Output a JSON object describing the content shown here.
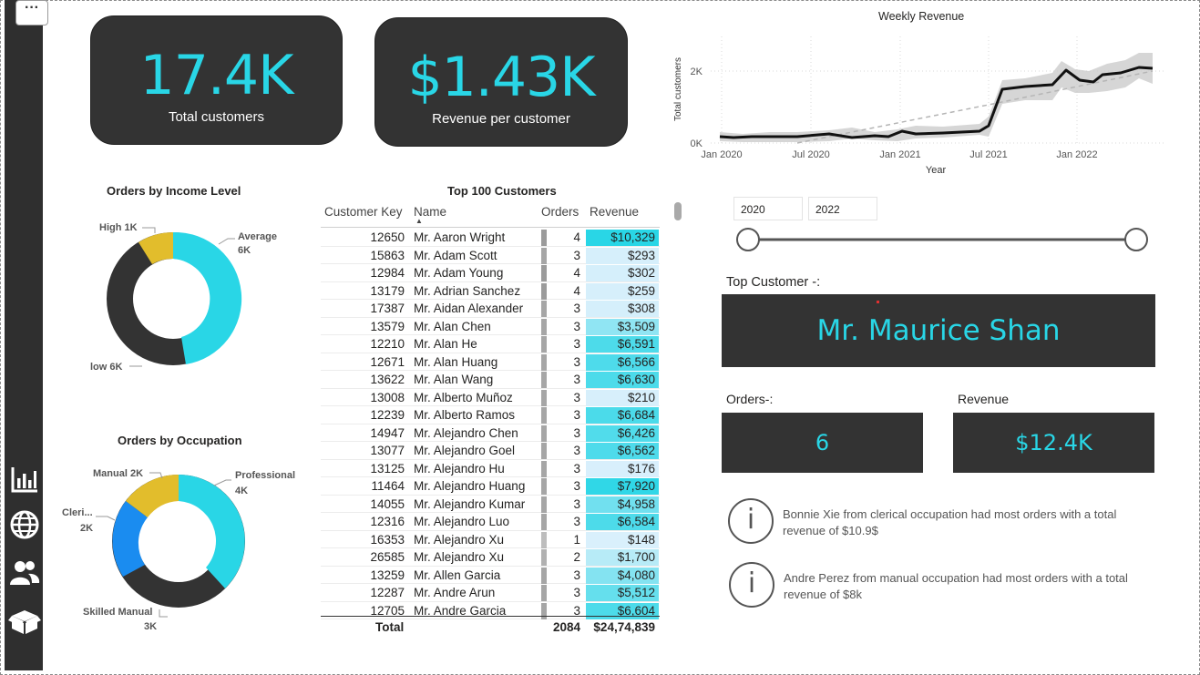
{
  "nav": {
    "more_label": "···",
    "icons": [
      "bar-chart-icon",
      "globe-icon",
      "users-icon",
      "box-icon"
    ]
  },
  "kpis": [
    {
      "value": "17.4K",
      "label": "Total customers"
    },
    {
      "value": "$1.43K",
      "label": "Revenue per customer"
    }
  ],
  "weekly_chart": {
    "title": "Weekly Revenue",
    "ylabel": "Total customers",
    "xlabel": "Year",
    "y_ticks": [
      "2K",
      "0K"
    ],
    "x_ticks": [
      "Jan 2020",
      "Jul 2020",
      "Jan 2021",
      "Jul 2021",
      "Jan 2022"
    ]
  },
  "income_chart": {
    "title": "Orders by Income Level",
    "labels": [
      {
        "name": "High",
        "value": "1K"
      },
      {
        "name": "Average",
        "value": "6K"
      },
      {
        "name": "low",
        "value": "6K"
      }
    ]
  },
  "occupation_chart": {
    "title": "Orders by Occupation",
    "labels": [
      {
        "name": "Manual",
        "value": "2K"
      },
      {
        "name": "Professional",
        "value": "4K"
      },
      {
        "name": "Cleri...",
        "value": "2K"
      },
      {
        "name": "Skilled Manual",
        "value": "3K"
      }
    ]
  },
  "table": {
    "title": "Top 100 Customers",
    "headers": {
      "key": "Customer Key",
      "name": "Name",
      "orders": "Orders",
      "revenue": "Revenue"
    },
    "rows": [
      {
        "key": "12650",
        "name": "Mr. Aaron Wright",
        "orders": "4",
        "revenue": "$10,329"
      },
      {
        "key": "15863",
        "name": "Mr. Adam Scott",
        "orders": "3",
        "revenue": "$293"
      },
      {
        "key": "12984",
        "name": "Mr. Adam Young",
        "orders": "4",
        "revenue": "$302"
      },
      {
        "key": "13179",
        "name": "Mr. Adrian Sanchez",
        "orders": "4",
        "revenue": "$259"
      },
      {
        "key": "17387",
        "name": "Mr. Aidan Alexander",
        "orders": "3",
        "revenue": "$308"
      },
      {
        "key": "13579",
        "name": "Mr. Alan Chen",
        "orders": "3",
        "revenue": "$3,509"
      },
      {
        "key": "12210",
        "name": "Mr. Alan He",
        "orders": "3",
        "revenue": "$6,591"
      },
      {
        "key": "12671",
        "name": "Mr. Alan Huang",
        "orders": "3",
        "revenue": "$6,566"
      },
      {
        "key": "13622",
        "name": "Mr. Alan Wang",
        "orders": "3",
        "revenue": "$6,630"
      },
      {
        "key": "13008",
        "name": "Mr. Alberto Muñoz",
        "orders": "3",
        "revenue": "$210"
      },
      {
        "key": "12239",
        "name": "Mr. Alberto Ramos",
        "orders": "3",
        "revenue": "$6,684"
      },
      {
        "key": "14947",
        "name": "Mr. Alejandro Chen",
        "orders": "3",
        "revenue": "$6,426"
      },
      {
        "key": "13077",
        "name": "Mr. Alejandro Goel",
        "orders": "3",
        "revenue": "$6,562"
      },
      {
        "key": "13125",
        "name": "Mr. Alejandro Hu",
        "orders": "3",
        "revenue": "$176"
      },
      {
        "key": "11464",
        "name": "Mr. Alejandro Huang",
        "orders": "3",
        "revenue": "$7,920"
      },
      {
        "key": "14055",
        "name": "Mr. Alejandro Kumar",
        "orders": "3",
        "revenue": "$4,958"
      },
      {
        "key": "12316",
        "name": "Mr. Alejandro Luo",
        "orders": "3",
        "revenue": "$6,584"
      },
      {
        "key": "16353",
        "name": "Mr. Alejandro Xu",
        "orders": "1",
        "revenue": "$148"
      },
      {
        "key": "26585",
        "name": "Mr. Alejandro Xu",
        "orders": "2",
        "revenue": "$1,700"
      },
      {
        "key": "13259",
        "name": "Mr. Allen Garcia",
        "orders": "3",
        "revenue": "$4,080"
      },
      {
        "key": "12287",
        "name": "Mr. Andre Arun",
        "orders": "3",
        "revenue": "$5,512"
      },
      {
        "key": "12705",
        "name": "Mr. Andre Garcia",
        "orders": "3",
        "revenue": "$6,604"
      }
    ],
    "total": {
      "label": "Total",
      "orders": "2084",
      "revenue": "$24,74,839"
    }
  },
  "slicer": {
    "start": "2020",
    "end": "2022"
  },
  "top_customer": {
    "label": "Top Customer -:",
    "name": "Mr. Maurice Shan"
  },
  "orders_card": {
    "label": "Orders-:",
    "value": "6"
  },
  "revenue_card": {
    "label": "Revenue",
    "value": "$12.4K"
  },
  "insights": [
    {
      "icon": "i",
      "text": "Bonnie Xie from clerical occupation had most orders with a total revenue of $10.9$"
    },
    {
      "icon": "i",
      "text": "Andre Perez from manual occupation had most orders with a total revenue of $8k"
    }
  ],
  "colors": {
    "accent": "#29d6e6",
    "dark": "#333333",
    "yellow": "#e2bd2c",
    "blue": "#1a8cf0",
    "ring_dark": "#333333"
  }
}
